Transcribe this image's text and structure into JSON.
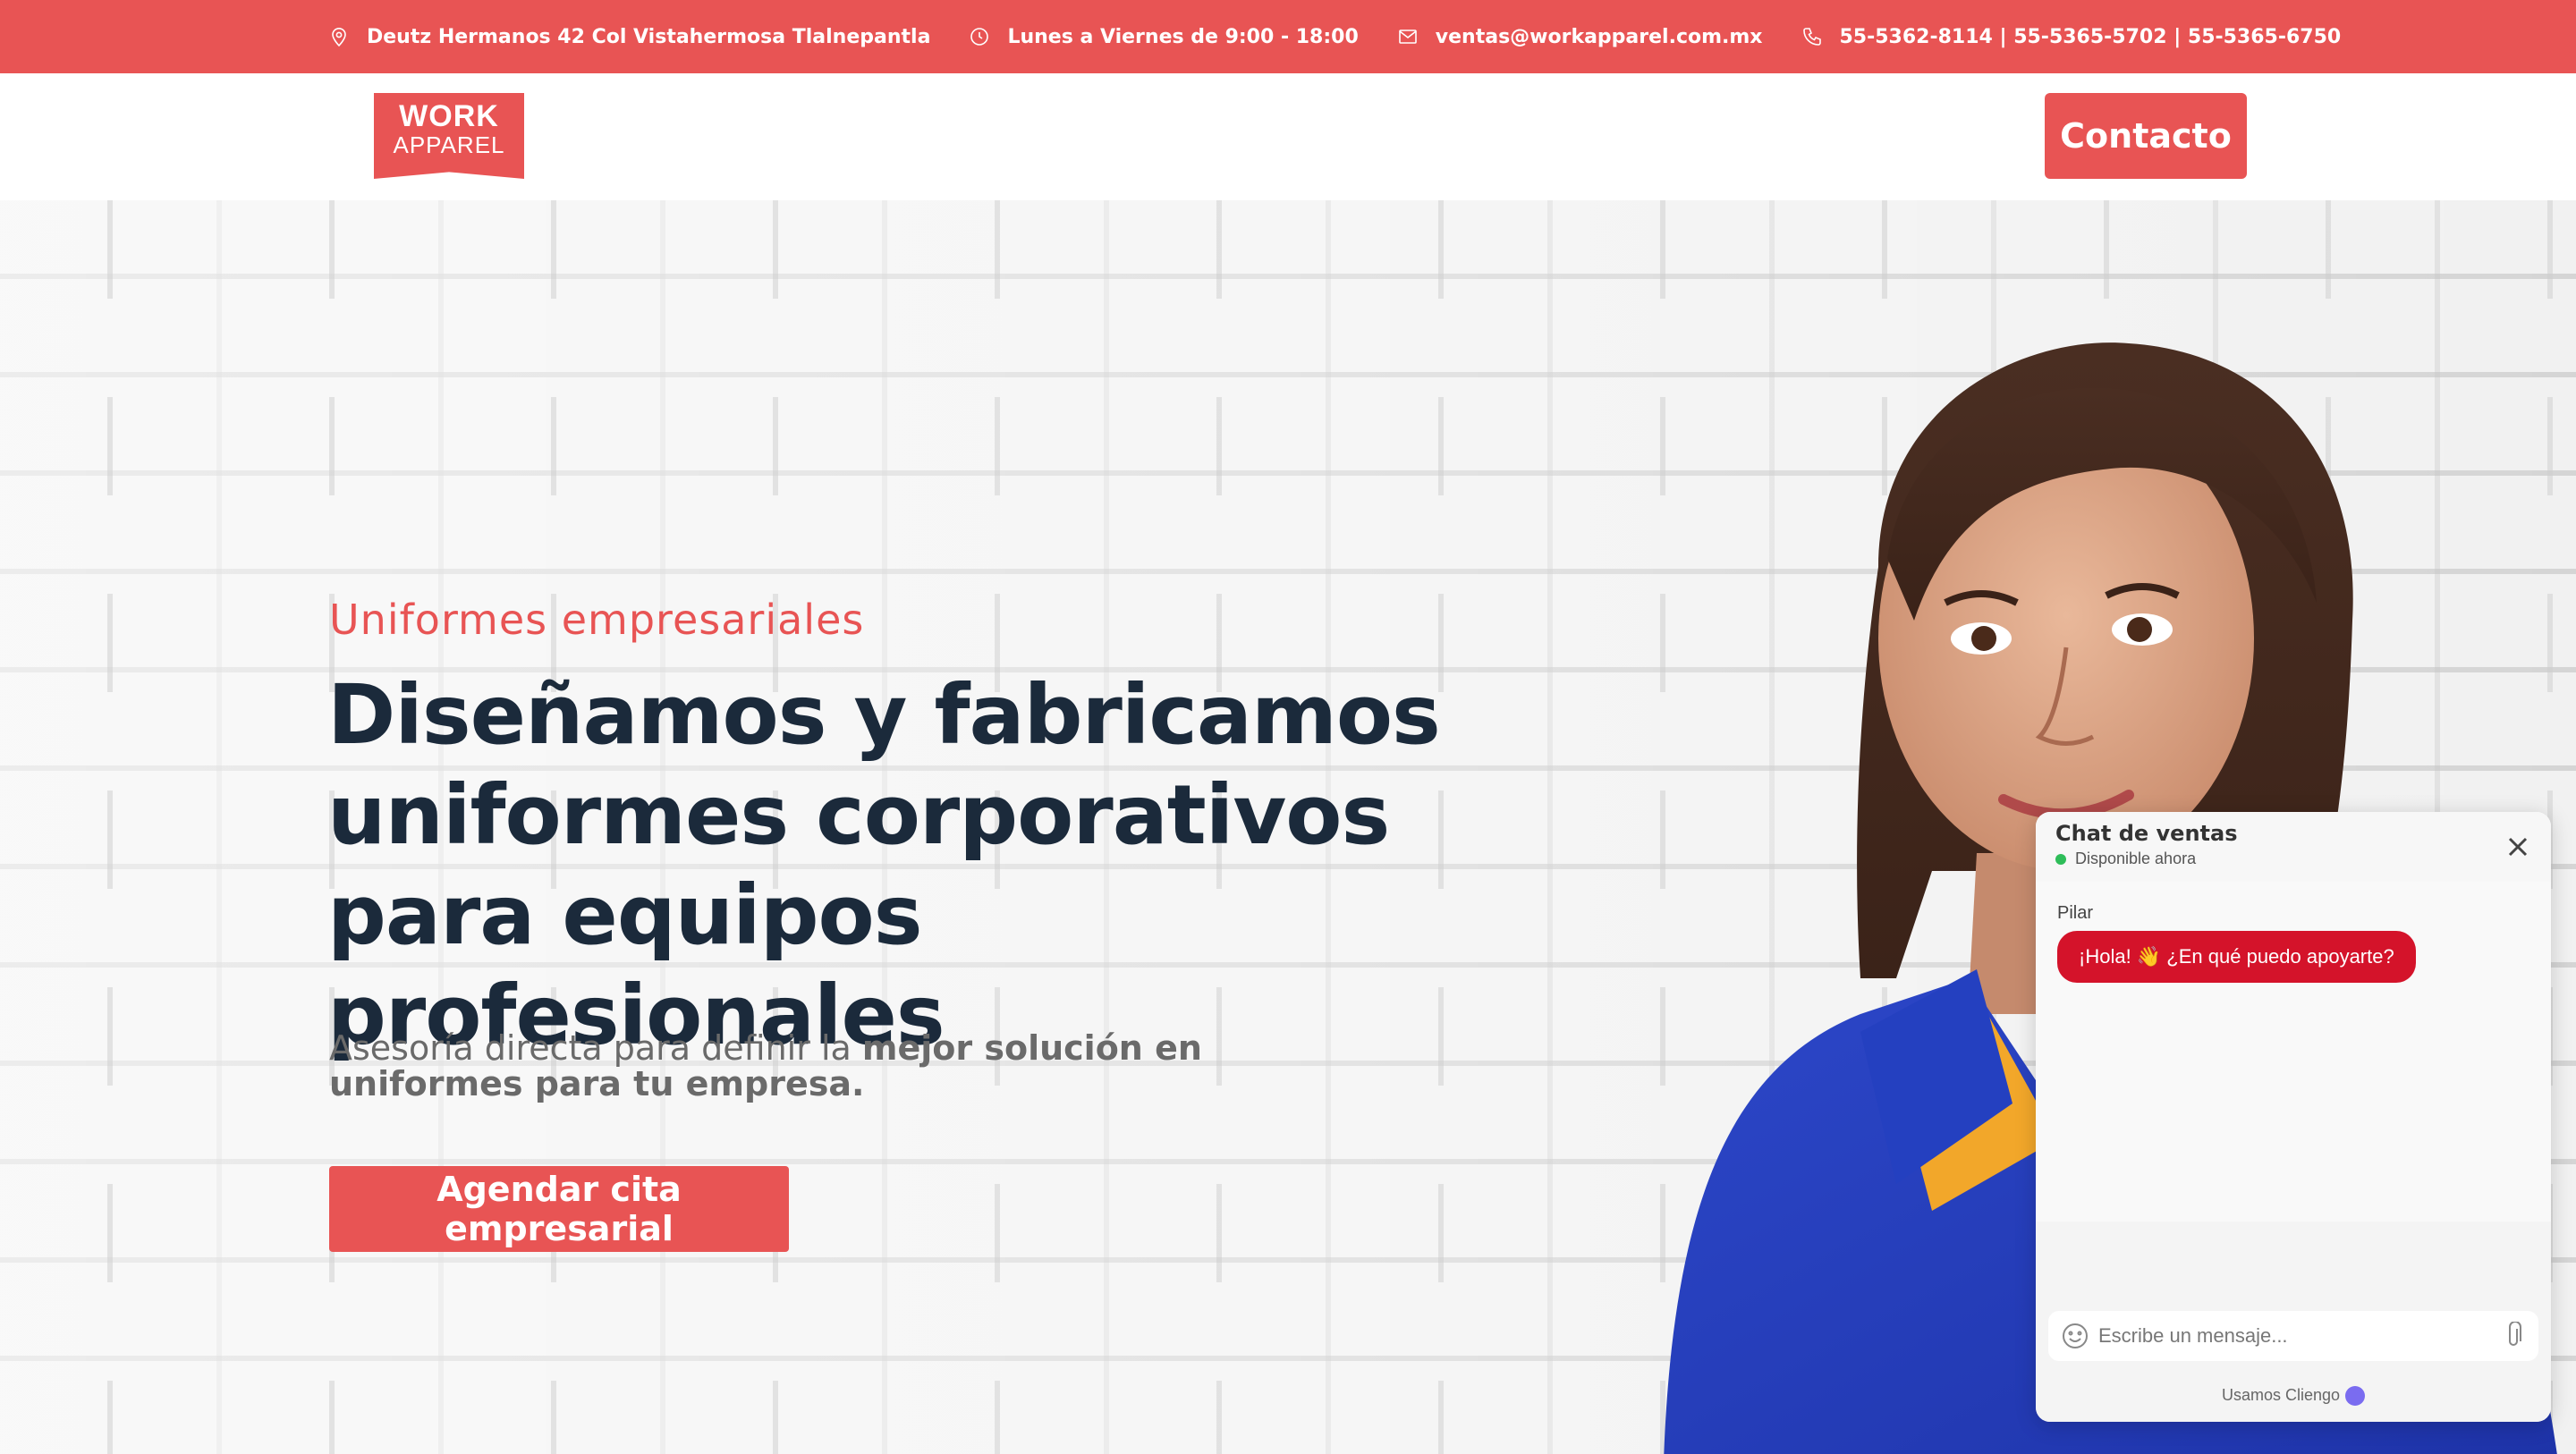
{
  "topbar": {
    "address": "Deutz Hermanos 42 Col Vistahermosa Tlalnepantla",
    "hours": "Lunes a Viernes de 9:00 - 18:00",
    "email": "ventas@workapparel.com.mx",
    "phones": "55-5362-8114 | 55-5365-5702 | 55-5365-6750",
    "icons": [
      "location-pin-icon",
      "clock-icon",
      "envelope-icon",
      "phone-icon"
    ]
  },
  "header": {
    "logo_line1": "WORK",
    "logo_line2": "APPAREL",
    "contact_label": "Contacto"
  },
  "hero": {
    "eyebrow": "Uniformes empresariales",
    "headline": "Diseñamos y fabricamos uniformes corporativos para equipos profesionales",
    "subtext_normal": "Asesoría directa para definir la ",
    "subtext_bold": "mejor solución en uniformes para tu empresa.",
    "cta_label": "Agendar cita empresarial"
  },
  "chat": {
    "title": "Chat de ventas",
    "status": "Disponible ahora",
    "sender": "Pilar",
    "message": "¡Hola! 👋 ¿En qué puedo apoyarte?",
    "input_placeholder": "Escribe un mensaje...",
    "powered_by": "Usamos Cliengo"
  },
  "colors": {
    "brand_red": "#e85454",
    "headline_navy": "#1b2a3b",
    "chat_bubble": "#d4132a",
    "status_green": "#2ebd59"
  }
}
